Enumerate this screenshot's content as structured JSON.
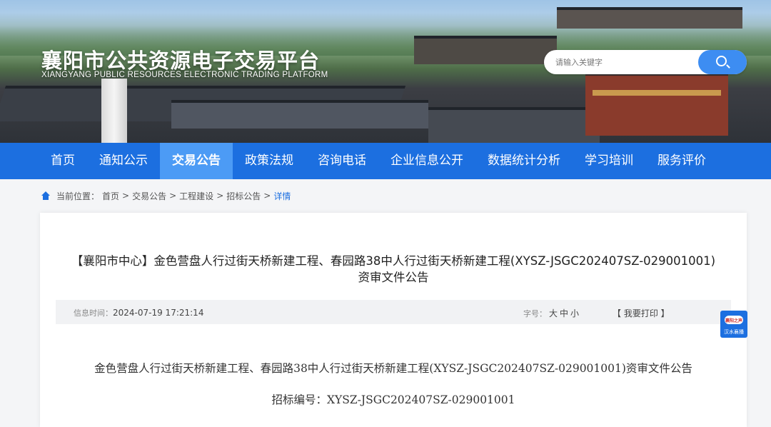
{
  "header": {
    "site_title": "襄阳市公共资源电子交易平台",
    "site_subtitle": "XIANGYANG PUBLIC RESOURCES ELECTRONIC TRADING PLATFORM",
    "search_placeholder": "请输入关键字",
    "search_icon": "search-icon"
  },
  "nav": {
    "items": [
      {
        "label": "首页"
      },
      {
        "label": "通知公示"
      },
      {
        "label": "交易公告"
      },
      {
        "label": "政策法规"
      },
      {
        "label": "咨询电话"
      },
      {
        "label": "企业信息公开"
      },
      {
        "label": "数据统计分析"
      },
      {
        "label": "学习培训"
      },
      {
        "label": "服务评价"
      }
    ],
    "active_index": 2,
    "colors": {
      "bar": "#1c6fe0",
      "active": "#4c9bf5"
    }
  },
  "breadcrumb": {
    "prefix": "当前位置：",
    "items": [
      "首页",
      "交易公告",
      "工程建设",
      "招标公告",
      "详情"
    ],
    "separator": ">"
  },
  "article": {
    "title": "【襄阳市中心】金色营盘人行过街天桥新建工程、春园路38中人行过街天桥新建工程(XYSZ-JSGC202407SZ-029001001)资审文件公告",
    "info_time_label": "信息时间：",
    "info_time_value": "2024-07-19 17:21:14",
    "font_size_label": "字号：",
    "font_size_large": "大",
    "font_size_medium": "中",
    "font_size_small": "小",
    "print_label": "【 我要打印 】",
    "body_line_1": "金色营盘人行过街天桥新建工程、春园路38中人行过街天桥新建工程(XYSZ-JSGC202407SZ-029001001)资审文件公告",
    "body_line_2": "招标编号：XYSZ-JSGC202407SZ-029001001"
  },
  "side_badge": {
    "line1": "襄阳之声",
    "line2": "汉水襄播"
  }
}
